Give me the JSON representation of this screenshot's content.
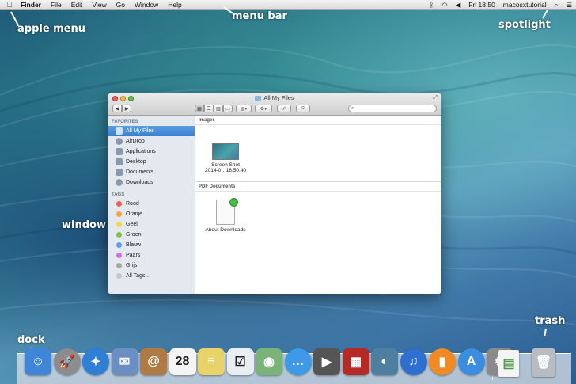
{
  "menubar": {
    "apple_icon": "apple-icon",
    "items": [
      "Finder",
      "File",
      "Edit",
      "View",
      "Go",
      "Window",
      "Help"
    ],
    "clock": "Fri 18:50",
    "user": "macosxtutorial",
    "status_icons": [
      "bluetooth-icon",
      "wifi-icon",
      "volume-icon"
    ]
  },
  "annotations": {
    "apple_menu": "apple menu",
    "menu_bar": "menu bar",
    "spotlight": "spotlight",
    "window": "window",
    "dock": "dock",
    "trash": "trash"
  },
  "window": {
    "title": "All My Files",
    "sidebar": {
      "favorites_header": "FAVORITES",
      "favorites": [
        "All My Files",
        "AirDrop",
        "Applications",
        "Desktop",
        "Documents",
        "Downloads"
      ],
      "tags_header": "TAGS",
      "tags": [
        {
          "label": "Rood",
          "color": "#f05b53"
        },
        {
          "label": "Oranje",
          "color": "#f7a13a"
        },
        {
          "label": "Geel",
          "color": "#f6d93b"
        },
        {
          "label": "Groen",
          "color": "#7cc23f"
        },
        {
          "label": "Blauw",
          "color": "#5a9de0"
        },
        {
          "label": "Paars",
          "color": "#d46fd6"
        },
        {
          "label": "Grijs",
          "color": "#a8a8a8"
        },
        {
          "label": "All Tags…",
          "color": "#c8c8c8"
        }
      ]
    },
    "groups": [
      {
        "title": "Images",
        "file": {
          "line1": "Screen Shot",
          "line2": "2014-0…18.50.40"
        }
      },
      {
        "title": "PDF Documents",
        "file": {
          "line1": "About Downloads",
          "line2": ""
        }
      }
    ]
  },
  "dock": {
    "icons": [
      {
        "name": "finder-icon",
        "color": "#3f86d8",
        "glyph": "☺"
      },
      {
        "name": "launchpad-icon",
        "color": "#8c8c8c",
        "glyph": "🚀"
      },
      {
        "name": "safari-icon",
        "color": "#2f7fd6",
        "glyph": "✦"
      },
      {
        "name": "mail-icon",
        "color": "#6b8fc2",
        "glyph": "✉"
      },
      {
        "name": "contacts-icon",
        "color": "#b07a45",
        "glyph": "@"
      },
      {
        "name": "calendar-icon",
        "color": "#f4f4f4",
        "glyph": "28"
      },
      {
        "name": "notes-icon",
        "color": "#e8d36a",
        "glyph": "≡"
      },
      {
        "name": "reminders-icon",
        "color": "#e9eef3",
        "glyph": "☑"
      },
      {
        "name": "maps-icon",
        "color": "#7ab37a",
        "glyph": "◉"
      },
      {
        "name": "messages-icon",
        "color": "#3e9ae8",
        "glyph": "…"
      },
      {
        "name": "facetime-icon",
        "color": "#555555",
        "glyph": "▶"
      },
      {
        "name": "photobooth-icon",
        "color": "#b52a27",
        "glyph": "▦"
      },
      {
        "name": "iphoto-icon",
        "color": "#4f7fa0",
        "glyph": "◐"
      },
      {
        "name": "itunes-icon",
        "color": "#2f6fd0",
        "glyph": "♫"
      },
      {
        "name": "ibooks-icon",
        "color": "#ef8a25",
        "glyph": "▮"
      },
      {
        "name": "appstore-icon",
        "color": "#3a8de0",
        "glyph": "A"
      },
      {
        "name": "system-preferences-icon",
        "color": "#8a8a8a",
        "glyph": "⚙"
      },
      {
        "name": "document-stack-icon",
        "color": "#f4f4f4",
        "glyph": "▤"
      },
      {
        "name": "trash-icon",
        "color": "#b7bcc2",
        "glyph": "🗑"
      }
    ]
  }
}
